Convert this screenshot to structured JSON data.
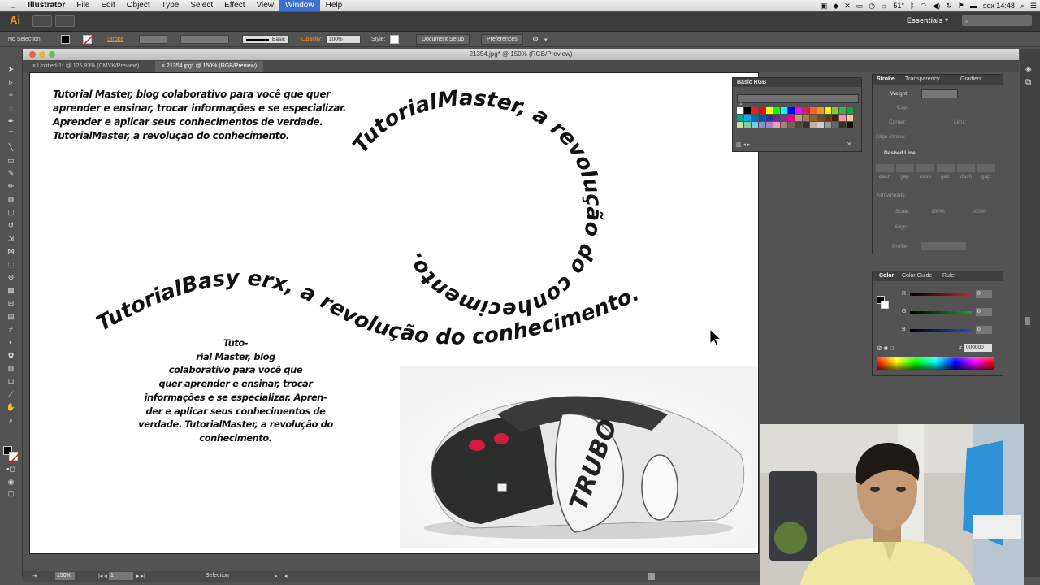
{
  "menubar": {
    "app_name": "Illustrator",
    "items": [
      "File",
      "Edit",
      "Object",
      "Type",
      "Select",
      "Effect",
      "View",
      "Window",
      "Help"
    ],
    "active_item": "Window",
    "status": {
      "temperature": "51°",
      "clock": "sex 14:48"
    }
  },
  "appbar": {
    "logo": "Ai",
    "workspace": "Essentials",
    "search_placeholder": ""
  },
  "control_bar": {
    "selection_label": "No Selection",
    "stroke_label": "Stroke",
    "brush_label": "Basic",
    "opacity_label": "Opacity:",
    "opacity_value": "100%",
    "style_label": "Style:",
    "document_setup": "Document Setup",
    "preferences": "Preferences"
  },
  "window": {
    "title": "21354.jpg* @ 150% (RGB/Preview)",
    "tabs": [
      {
        "label": "Untitled-1* @ 125,83% (CMYK/Preview)",
        "active": false
      },
      {
        "label": "21354.jpg* @ 150% (RGB/Preview)",
        "active": true
      }
    ]
  },
  "artboard": {
    "paragraph_top": [
      "Tutorial Master, blog colaborativo para você que quer",
      "aprender e ensinar, trocar informações e se especializar.",
      "Aprender e aplicar seus conhecimentos de verdade.",
      "TutorialMaster, a revolução do conhecimento."
    ],
    "paragraph_bottom": [
      "Tuto-",
      "rial Master, blog",
      "colaborativo para você que",
      "quer aprender e ensinar, trocar",
      "informações e se especializar. Apren-",
      "der e aplicar seus conhecimentos de",
      "verdade.  TutorialMaster, a revolução do",
      "conhecimento."
    ],
    "spiral_text": "TutorialMaster, a revolução do conhecimento.",
    "wave_text": "TutorialBasy erx, a revolução do conhecimento.",
    "car_badge": "TRUBO"
  },
  "swatches_panel": {
    "title": "Basic RGB"
  },
  "stroke_panel": {
    "tabs": [
      "Stroke",
      "Transparency",
      "Gradient"
    ],
    "weight_label": "Weight:",
    "cap_label": "Cap:",
    "corner_label": "Corner:",
    "limit_label": "Limit:",
    "align_label": "Align Stroke:",
    "dashed_label": "Dashed Line",
    "dash_cells": [
      "dash",
      "gap",
      "dash",
      "gap",
      "dash",
      "gap"
    ],
    "arrowheads_label": "Arrowheads:",
    "scale_label": "Scale:",
    "scale_values": [
      "100%",
      "100%"
    ],
    "align2_label": "Align:",
    "profile_label": "Profile:"
  },
  "color_panel": {
    "tabs": [
      "Color",
      "Color Guide",
      "Ruler"
    ],
    "channels": [
      {
        "label": "R",
        "value": "0",
        "color": "#d12020"
      },
      {
        "label": "G",
        "value": "0",
        "color": "#20a020"
      },
      {
        "label": "B",
        "value": "0",
        "color": "#2a46d6"
      }
    ],
    "hex_label": "#",
    "hex_value": "000000"
  },
  "status_bar": {
    "zoom": "150%",
    "page": "1",
    "tool": "Selection"
  },
  "colors": {
    "accent": "#f7941d",
    "selection": "#3b6fd0",
    "panel_bg": "#535353"
  }
}
